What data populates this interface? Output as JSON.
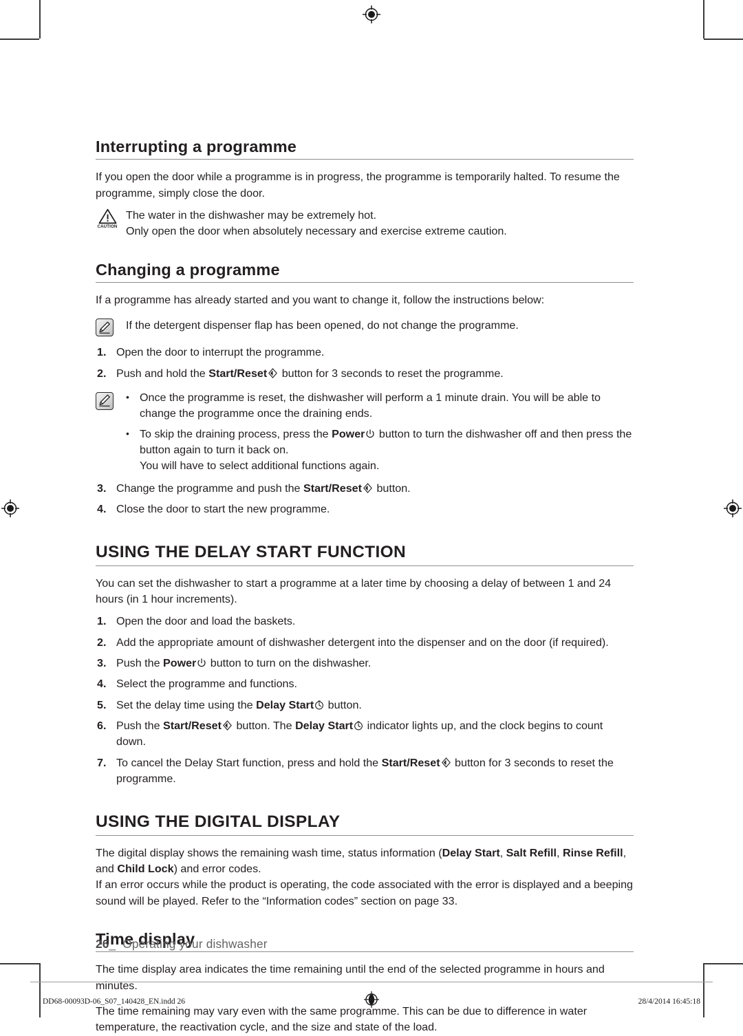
{
  "document": {
    "page_number": "26",
    "running_footer": "Operating your dishwasher",
    "imprint_file": "DD68-00093D-06_S07_140428_EN.indd   26",
    "imprint_timestamp": "28/4/2014   16:45:18"
  },
  "sections": [
    {
      "id": "interrupting",
      "heading": "Interrupting a programme",
      "intro": "If you open the door while a programme is in progress, the programme is temporarily halted. To resume the programme, simply close the door.",
      "caution": {
        "icon": "caution-triangle-icon",
        "icon_label": "CAUTION",
        "line1": "The water in the dishwasher may be extremely hot.",
        "line2": "Only open the door when absolutely necessary and exercise extreme caution."
      }
    },
    {
      "id": "changing",
      "heading": "Changing a programme",
      "intro": "If a programme has already started and you want to change it, follow the instructions below:",
      "note_top": {
        "icon": "note-pencil-icon",
        "text": "If the detergent dispenser flap has been opened, do not change the programme."
      },
      "steps_a": [
        {
          "n": "1.",
          "text": "Open the door to interrupt the programme."
        }
      ],
      "step2": {
        "n": "2.",
        "pre": "Push and hold the ",
        "bold": "Start/Reset",
        "symbol": "start-reset-diamond-icon",
        "post": " button for 3 seconds to reset the programme."
      },
      "note_bullets": {
        "icon": "note-pencil-icon",
        "items": [
          {
            "bullet": "•",
            "text": "Once the programme is reset, the dishwasher will perform a 1 minute drain. You will be able to change the programme once the draining ends."
          },
          {
            "bullet": "•",
            "pre": "To skip the draining process, press the ",
            "bold": "Power",
            "symbol": "power-icon",
            "post": " button to turn the dishwasher off and then press the button again to turn it back on.",
            "extra": "You will have to select additional functions again."
          }
        ]
      },
      "step3": {
        "n": "3.",
        "pre": "Change the programme and push the ",
        "bold": "Start/Reset",
        "symbol": "start-reset-diamond-icon",
        "post": " button."
      },
      "steps_b": [
        {
          "n": "4.",
          "text": "Close the door to start the new programme."
        }
      ]
    },
    {
      "id": "delay-start",
      "heading": "USING THE DELAY START FUNCTION",
      "intro": "You can set the dishwasher to start a programme at a later time by choosing a delay of between 1 and 24 hours (in 1 hour increments).",
      "steps": [
        {
          "n": "1.",
          "text": "Open the door and load the baskets."
        },
        {
          "n": "2.",
          "text": "Add the appropriate amount of dishwasher detergent into the dispenser and on the door (if required)."
        },
        {
          "n": "3.",
          "pre": "Push the ",
          "bold": "Power",
          "symbol": "power-icon",
          "post": " button to turn on the dishwasher."
        },
        {
          "n": "4.",
          "text": "Select the programme and functions."
        },
        {
          "n": "5.",
          "pre": "Set the delay time using the ",
          "bold": "Delay Start",
          "symbol": "clock-icon",
          "post": " button."
        },
        {
          "n": "6.",
          "pre": "Push the ",
          "bold": "Start/Reset",
          "symbol": "start-reset-diamond-icon",
          "mid": " button. The ",
          "bold2": "Delay Start",
          "symbol2": "clock-icon",
          "post": " indicator lights up, and the clock begins to count down."
        },
        {
          "n": "7.",
          "pre": "To cancel the Delay Start function, press and hold the ",
          "bold": "Start/Reset",
          "symbol": "start-reset-diamond-icon",
          "post": " button for 3 seconds to reset the programme."
        }
      ]
    },
    {
      "id": "digital-display",
      "heading": "USING THE DIGITAL DISPLAY",
      "para1_a": "The digital display shows the remaining wash time, status information (",
      "para1_b1": "Delay Start",
      "para1_c": ", ",
      "para1_b2": "Salt Refill",
      "para1_d": ", ",
      "para1_b3": "Rinse Refill",
      "para1_e": ", and ",
      "para1_b4": "Child Lock",
      "para1_f": ") and error codes.",
      "para2": "If an error occurs while the product is operating, the code associated with the error is displayed and a beeping sound will be played. Refer to the “Information codes” section on page 33."
    },
    {
      "id": "time-display",
      "heading": "Time display",
      "para1": "The time display area indicates the time remaining until the end of the selected programme in hours and minutes.",
      "para2": "The time remaining may vary even with the same programme. This can be due to difference in water temperature, the reactivation cycle, and the size and state of the load."
    }
  ]
}
